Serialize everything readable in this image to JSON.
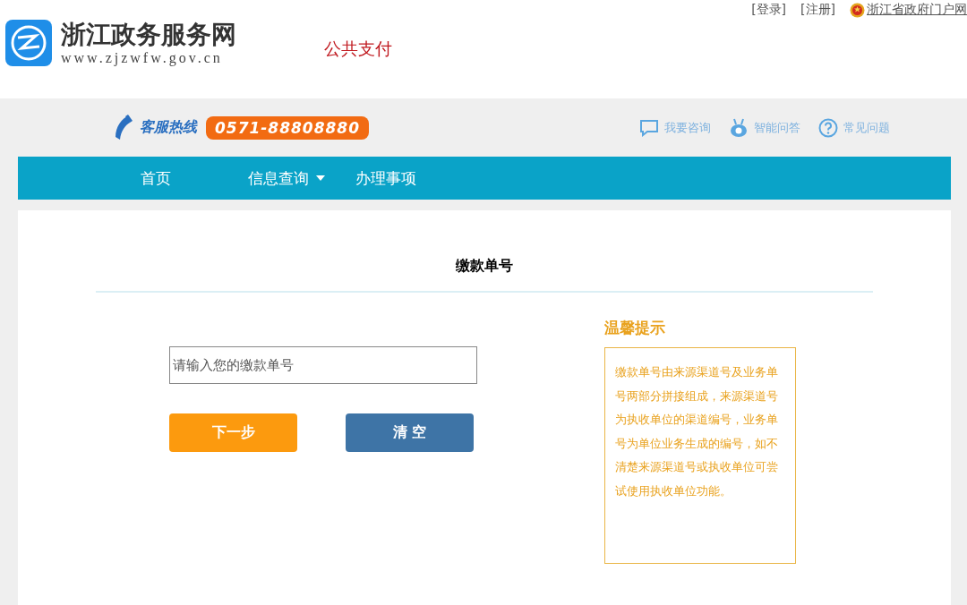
{
  "header": {
    "site_name": "浙江政务服务网",
    "site_url": "www.zjzwfw.gov.cn",
    "section": "公共支付",
    "top_links": [
      "[登录]",
      "[注册]"
    ],
    "portal_link": "浙江省政府门户网"
  },
  "hotline": {
    "label": "客服热线",
    "number": "0571-88808880"
  },
  "help_links": [
    {
      "kind": "chat",
      "label": "我要咨询"
    },
    {
      "kind": "robot",
      "label": "智能问答"
    },
    {
      "kind": "question",
      "label": "常见问题"
    }
  ],
  "nav": [
    {
      "label": "首页",
      "kind": "link"
    },
    {
      "label": "信息查询",
      "kind": "dropdown"
    },
    {
      "label": "办理事项",
      "kind": "link"
    }
  ],
  "form": {
    "title": "缴款单号",
    "input": {
      "placeholder": "请输入您的缴款单号"
    },
    "buttons": [
      {
        "label": "下一步",
        "kind": "primary"
      },
      {
        "label": "清 空",
        "kind": "secondary"
      }
    ]
  },
  "tips": {
    "title": "温馨提示",
    "text": "缴款单号由来源渠道号及业务单号两部分拼接组成，来源渠道号为执收单位的渠道编号，业务单号为单位业务生成的编号，如不清楚来源渠道号或执收单位可尝试使用执收单位功能。"
  }
}
